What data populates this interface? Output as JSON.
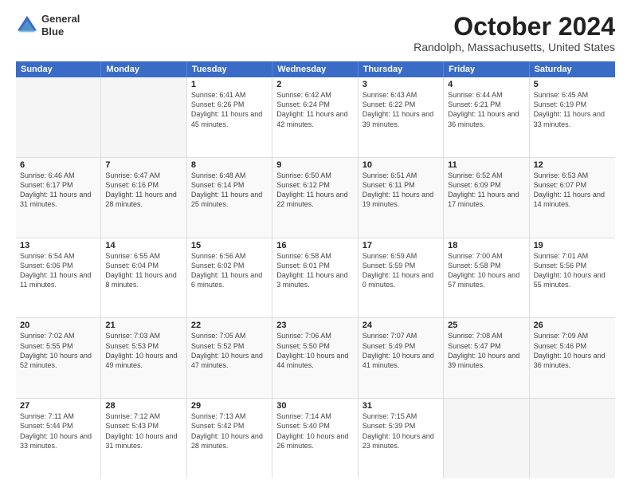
{
  "logo": {
    "line1": "General",
    "line2": "Blue"
  },
  "title": "October 2024",
  "location": "Randolph, Massachusetts, United States",
  "weekdays": [
    "Sunday",
    "Monday",
    "Tuesday",
    "Wednesday",
    "Thursday",
    "Friday",
    "Saturday"
  ],
  "weeks": [
    [
      {
        "day": "",
        "sunrise": "",
        "sunset": "",
        "daylight": "",
        "empty": true
      },
      {
        "day": "",
        "sunrise": "",
        "sunset": "",
        "daylight": "",
        "empty": true
      },
      {
        "day": "1",
        "sunrise": "Sunrise: 6:41 AM",
        "sunset": "Sunset: 6:26 PM",
        "daylight": "Daylight: 11 hours and 45 minutes.",
        "empty": false
      },
      {
        "day": "2",
        "sunrise": "Sunrise: 6:42 AM",
        "sunset": "Sunset: 6:24 PM",
        "daylight": "Daylight: 11 hours and 42 minutes.",
        "empty": false
      },
      {
        "day": "3",
        "sunrise": "Sunrise: 6:43 AM",
        "sunset": "Sunset: 6:22 PM",
        "daylight": "Daylight: 11 hours and 39 minutes.",
        "empty": false
      },
      {
        "day": "4",
        "sunrise": "Sunrise: 6:44 AM",
        "sunset": "Sunset: 6:21 PM",
        "daylight": "Daylight: 11 hours and 36 minutes.",
        "empty": false
      },
      {
        "day": "5",
        "sunrise": "Sunrise: 6:45 AM",
        "sunset": "Sunset: 6:19 PM",
        "daylight": "Daylight: 11 hours and 33 minutes.",
        "empty": false
      }
    ],
    [
      {
        "day": "6",
        "sunrise": "Sunrise: 6:46 AM",
        "sunset": "Sunset: 6:17 PM",
        "daylight": "Daylight: 11 hours and 31 minutes.",
        "empty": false
      },
      {
        "day": "7",
        "sunrise": "Sunrise: 6:47 AM",
        "sunset": "Sunset: 6:16 PM",
        "daylight": "Daylight: 11 hours and 28 minutes.",
        "empty": false
      },
      {
        "day": "8",
        "sunrise": "Sunrise: 6:48 AM",
        "sunset": "Sunset: 6:14 PM",
        "daylight": "Daylight: 11 hours and 25 minutes.",
        "empty": false
      },
      {
        "day": "9",
        "sunrise": "Sunrise: 6:50 AM",
        "sunset": "Sunset: 6:12 PM",
        "daylight": "Daylight: 11 hours and 22 minutes.",
        "empty": false
      },
      {
        "day": "10",
        "sunrise": "Sunrise: 6:51 AM",
        "sunset": "Sunset: 6:11 PM",
        "daylight": "Daylight: 11 hours and 19 minutes.",
        "empty": false
      },
      {
        "day": "11",
        "sunrise": "Sunrise: 6:52 AM",
        "sunset": "Sunset: 6:09 PM",
        "daylight": "Daylight: 11 hours and 17 minutes.",
        "empty": false
      },
      {
        "day": "12",
        "sunrise": "Sunrise: 6:53 AM",
        "sunset": "Sunset: 6:07 PM",
        "daylight": "Daylight: 11 hours and 14 minutes.",
        "empty": false
      }
    ],
    [
      {
        "day": "13",
        "sunrise": "Sunrise: 6:54 AM",
        "sunset": "Sunset: 6:06 PM",
        "daylight": "Daylight: 11 hours and 11 minutes.",
        "empty": false
      },
      {
        "day": "14",
        "sunrise": "Sunrise: 6:55 AM",
        "sunset": "Sunset: 6:04 PM",
        "daylight": "Daylight: 11 hours and 8 minutes.",
        "empty": false
      },
      {
        "day": "15",
        "sunrise": "Sunrise: 6:56 AM",
        "sunset": "Sunset: 6:02 PM",
        "daylight": "Daylight: 11 hours and 6 minutes.",
        "empty": false
      },
      {
        "day": "16",
        "sunrise": "Sunrise: 6:58 AM",
        "sunset": "Sunset: 6:01 PM",
        "daylight": "Daylight: 11 hours and 3 minutes.",
        "empty": false
      },
      {
        "day": "17",
        "sunrise": "Sunrise: 6:59 AM",
        "sunset": "Sunset: 5:59 PM",
        "daylight": "Daylight: 11 hours and 0 minutes.",
        "empty": false
      },
      {
        "day": "18",
        "sunrise": "Sunrise: 7:00 AM",
        "sunset": "Sunset: 5:58 PM",
        "daylight": "Daylight: 10 hours and 57 minutes.",
        "empty": false
      },
      {
        "day": "19",
        "sunrise": "Sunrise: 7:01 AM",
        "sunset": "Sunset: 5:56 PM",
        "daylight": "Daylight: 10 hours and 55 minutes.",
        "empty": false
      }
    ],
    [
      {
        "day": "20",
        "sunrise": "Sunrise: 7:02 AM",
        "sunset": "Sunset: 5:55 PM",
        "daylight": "Daylight: 10 hours and 52 minutes.",
        "empty": false
      },
      {
        "day": "21",
        "sunrise": "Sunrise: 7:03 AM",
        "sunset": "Sunset: 5:53 PM",
        "daylight": "Daylight: 10 hours and 49 minutes.",
        "empty": false
      },
      {
        "day": "22",
        "sunrise": "Sunrise: 7:05 AM",
        "sunset": "Sunset: 5:52 PM",
        "daylight": "Daylight: 10 hours and 47 minutes.",
        "empty": false
      },
      {
        "day": "23",
        "sunrise": "Sunrise: 7:06 AM",
        "sunset": "Sunset: 5:50 PM",
        "daylight": "Daylight: 10 hours and 44 minutes.",
        "empty": false
      },
      {
        "day": "24",
        "sunrise": "Sunrise: 7:07 AM",
        "sunset": "Sunset: 5:49 PM",
        "daylight": "Daylight: 10 hours and 41 minutes.",
        "empty": false
      },
      {
        "day": "25",
        "sunrise": "Sunrise: 7:08 AM",
        "sunset": "Sunset: 5:47 PM",
        "daylight": "Daylight: 10 hours and 39 minutes.",
        "empty": false
      },
      {
        "day": "26",
        "sunrise": "Sunrise: 7:09 AM",
        "sunset": "Sunset: 5:46 PM",
        "daylight": "Daylight: 10 hours and 36 minutes.",
        "empty": false
      }
    ],
    [
      {
        "day": "27",
        "sunrise": "Sunrise: 7:11 AM",
        "sunset": "Sunset: 5:44 PM",
        "daylight": "Daylight: 10 hours and 33 minutes.",
        "empty": false
      },
      {
        "day": "28",
        "sunrise": "Sunrise: 7:12 AM",
        "sunset": "Sunset: 5:43 PM",
        "daylight": "Daylight: 10 hours and 31 minutes.",
        "empty": false
      },
      {
        "day": "29",
        "sunrise": "Sunrise: 7:13 AM",
        "sunset": "Sunset: 5:42 PM",
        "daylight": "Daylight: 10 hours and 28 minutes.",
        "empty": false
      },
      {
        "day": "30",
        "sunrise": "Sunrise: 7:14 AM",
        "sunset": "Sunset: 5:40 PM",
        "daylight": "Daylight: 10 hours and 26 minutes.",
        "empty": false
      },
      {
        "day": "31",
        "sunrise": "Sunrise: 7:15 AM",
        "sunset": "Sunset: 5:39 PM",
        "daylight": "Daylight: 10 hours and 23 minutes.",
        "empty": false
      },
      {
        "day": "",
        "sunrise": "",
        "sunset": "",
        "daylight": "",
        "empty": true
      },
      {
        "day": "",
        "sunrise": "",
        "sunset": "",
        "daylight": "",
        "empty": true
      }
    ]
  ]
}
